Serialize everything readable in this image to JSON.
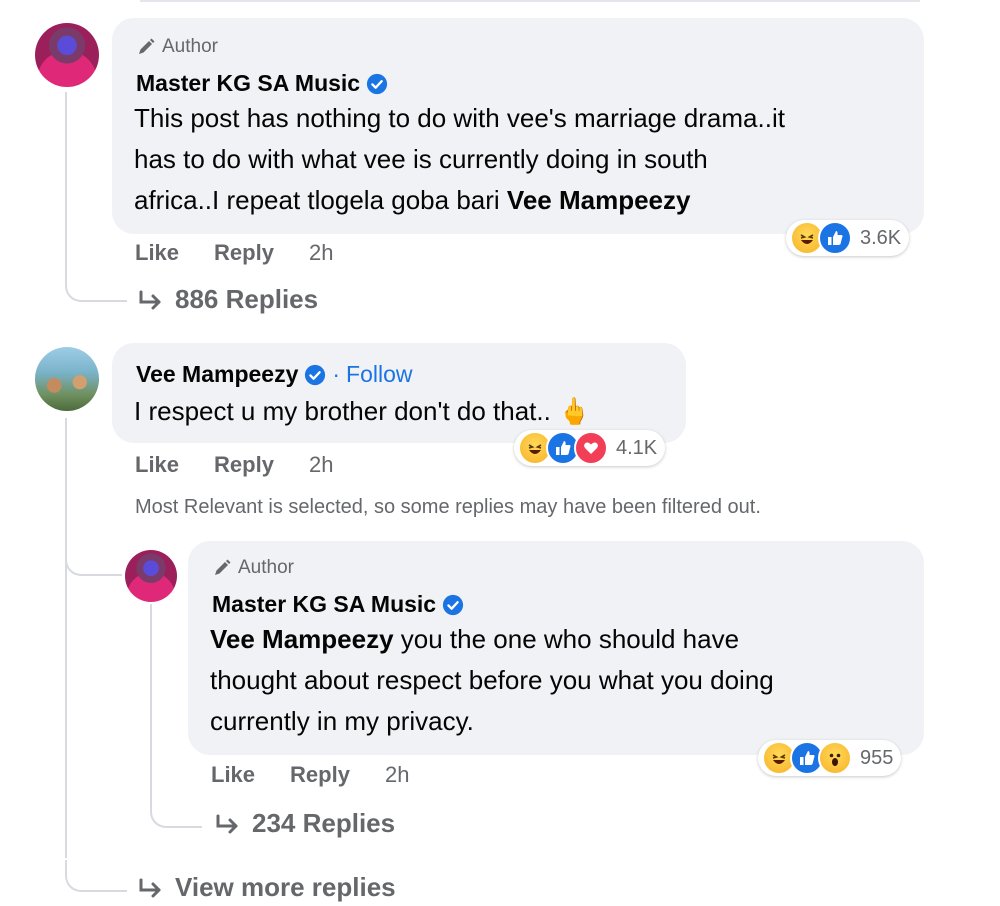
{
  "comments": [
    {
      "author_badge": "Author",
      "name": "Master KG SA Music",
      "text_lines": [
        "This post has nothing to do with vee's marriage drama..it",
        "has to do with what vee is currently doing in south"
      ],
      "text_line3_prefix": "africa..I repeat tlogela goba bari ",
      "text_line3_mention": "Vee Mampeezy",
      "like": "Like",
      "reply": "Reply",
      "time": "2h",
      "reaction_count": "3.6K",
      "replies_link": "886 Replies"
    },
    {
      "name": "Vee Mampeezy",
      "separator": "·",
      "follow": "Follow",
      "text": "I respect u my brother don't do that.. 🖕",
      "like": "Like",
      "reply": "Reply",
      "time": "2h",
      "reaction_count": "4.1K",
      "filter_note": "Most Relevant is selected, so some replies may have been filtered out."
    },
    {
      "author_badge": "Author",
      "name": "Master KG SA Music",
      "mention": "Vee Mampeezy",
      "text_line1_rest": " you the one who should have",
      "text_lines": [
        "thought about respect before you what you doing",
        "currently in my privacy."
      ],
      "like": "Like",
      "reply": "Reply",
      "time": "2h",
      "reaction_count": "955",
      "replies_link": "234 Replies"
    }
  ],
  "view_more": "View more replies",
  "colors": {
    "bubble": "#f0f2f5",
    "accent": "#1b74e4",
    "secondary_text": "#65676b"
  }
}
